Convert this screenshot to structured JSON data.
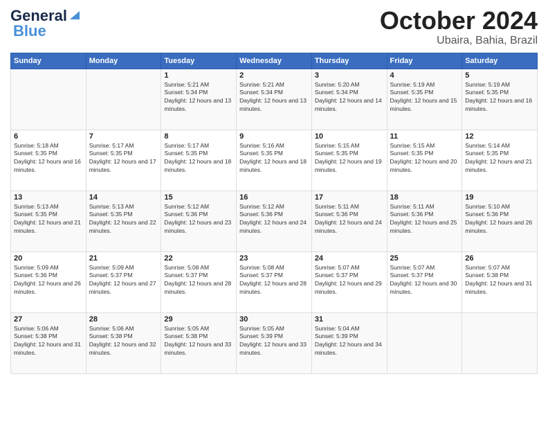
{
  "header": {
    "logo_general": "General",
    "logo_blue": "Blue",
    "month_title": "October 2024",
    "location": "Ubaira, Bahia, Brazil"
  },
  "days_of_week": [
    "Sunday",
    "Monday",
    "Tuesday",
    "Wednesday",
    "Thursday",
    "Friday",
    "Saturday"
  ],
  "weeks": [
    [
      {
        "day": "",
        "info": ""
      },
      {
        "day": "",
        "info": ""
      },
      {
        "day": "1",
        "info": "Sunrise: 5:21 AM\nSunset: 5:34 PM\nDaylight: 12 hours and 13 minutes."
      },
      {
        "day": "2",
        "info": "Sunrise: 5:21 AM\nSunset: 5:34 PM\nDaylight: 12 hours and 13 minutes."
      },
      {
        "day": "3",
        "info": "Sunrise: 5:20 AM\nSunset: 5:34 PM\nDaylight: 12 hours and 14 minutes."
      },
      {
        "day": "4",
        "info": "Sunrise: 5:19 AM\nSunset: 5:35 PM\nDaylight: 12 hours and 15 minutes."
      },
      {
        "day": "5",
        "info": "Sunrise: 5:19 AM\nSunset: 5:35 PM\nDaylight: 12 hours and 16 minutes."
      }
    ],
    [
      {
        "day": "6",
        "info": "Sunrise: 5:18 AM\nSunset: 5:35 PM\nDaylight: 12 hours and 16 minutes."
      },
      {
        "day": "7",
        "info": "Sunrise: 5:17 AM\nSunset: 5:35 PM\nDaylight: 12 hours and 17 minutes."
      },
      {
        "day": "8",
        "info": "Sunrise: 5:17 AM\nSunset: 5:35 PM\nDaylight: 12 hours and 18 minutes."
      },
      {
        "day": "9",
        "info": "Sunrise: 5:16 AM\nSunset: 5:35 PM\nDaylight: 12 hours and 18 minutes."
      },
      {
        "day": "10",
        "info": "Sunrise: 5:15 AM\nSunset: 5:35 PM\nDaylight: 12 hours and 19 minutes."
      },
      {
        "day": "11",
        "info": "Sunrise: 5:15 AM\nSunset: 5:35 PM\nDaylight: 12 hours and 20 minutes."
      },
      {
        "day": "12",
        "info": "Sunrise: 5:14 AM\nSunset: 5:35 PM\nDaylight: 12 hours and 21 minutes."
      }
    ],
    [
      {
        "day": "13",
        "info": "Sunrise: 5:13 AM\nSunset: 5:35 PM\nDaylight: 12 hours and 21 minutes."
      },
      {
        "day": "14",
        "info": "Sunrise: 5:13 AM\nSunset: 5:35 PM\nDaylight: 12 hours and 22 minutes."
      },
      {
        "day": "15",
        "info": "Sunrise: 5:12 AM\nSunset: 5:36 PM\nDaylight: 12 hours and 23 minutes."
      },
      {
        "day": "16",
        "info": "Sunrise: 5:12 AM\nSunset: 5:36 PM\nDaylight: 12 hours and 24 minutes."
      },
      {
        "day": "17",
        "info": "Sunrise: 5:11 AM\nSunset: 5:36 PM\nDaylight: 12 hours and 24 minutes."
      },
      {
        "day": "18",
        "info": "Sunrise: 5:11 AM\nSunset: 5:36 PM\nDaylight: 12 hours and 25 minutes."
      },
      {
        "day": "19",
        "info": "Sunrise: 5:10 AM\nSunset: 5:36 PM\nDaylight: 12 hours and 26 minutes."
      }
    ],
    [
      {
        "day": "20",
        "info": "Sunrise: 5:09 AM\nSunset: 5:36 PM\nDaylight: 12 hours and 26 minutes."
      },
      {
        "day": "21",
        "info": "Sunrise: 5:09 AM\nSunset: 5:37 PM\nDaylight: 12 hours and 27 minutes."
      },
      {
        "day": "22",
        "info": "Sunrise: 5:08 AM\nSunset: 5:37 PM\nDaylight: 12 hours and 28 minutes."
      },
      {
        "day": "23",
        "info": "Sunrise: 5:08 AM\nSunset: 5:37 PM\nDaylight: 12 hours and 28 minutes."
      },
      {
        "day": "24",
        "info": "Sunrise: 5:07 AM\nSunset: 5:37 PM\nDaylight: 12 hours and 29 minutes."
      },
      {
        "day": "25",
        "info": "Sunrise: 5:07 AM\nSunset: 5:37 PM\nDaylight: 12 hours and 30 minutes."
      },
      {
        "day": "26",
        "info": "Sunrise: 5:07 AM\nSunset: 5:38 PM\nDaylight: 12 hours and 31 minutes."
      }
    ],
    [
      {
        "day": "27",
        "info": "Sunrise: 5:06 AM\nSunset: 5:38 PM\nDaylight: 12 hours and 31 minutes."
      },
      {
        "day": "28",
        "info": "Sunrise: 5:06 AM\nSunset: 5:38 PM\nDaylight: 12 hours and 32 minutes."
      },
      {
        "day": "29",
        "info": "Sunrise: 5:05 AM\nSunset: 5:38 PM\nDaylight: 12 hours and 33 minutes."
      },
      {
        "day": "30",
        "info": "Sunrise: 5:05 AM\nSunset: 5:39 PM\nDaylight: 12 hours and 33 minutes."
      },
      {
        "day": "31",
        "info": "Sunrise: 5:04 AM\nSunset: 5:39 PM\nDaylight: 12 hours and 34 minutes."
      },
      {
        "day": "",
        "info": ""
      },
      {
        "day": "",
        "info": ""
      }
    ]
  ]
}
